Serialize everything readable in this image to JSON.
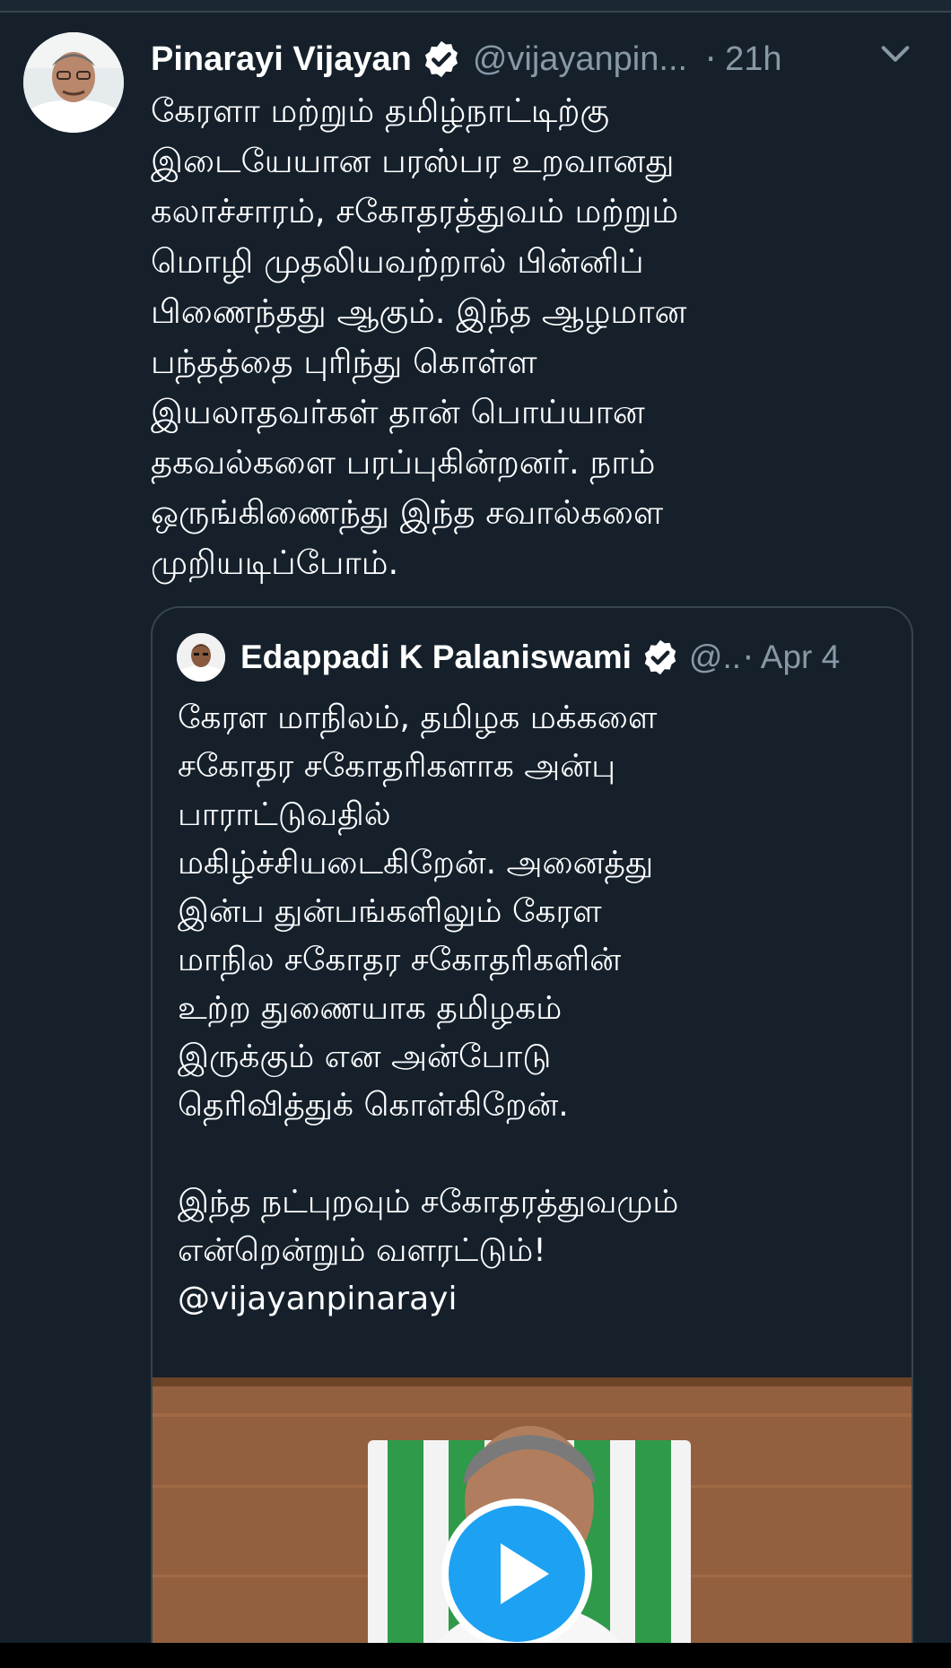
{
  "tweet": {
    "author_name": "Pinarayi Vijayan",
    "author_handle": "@vijayanpin...",
    "time": "21h",
    "separator": "·",
    "text": "கேரளா மற்றும் தமிழ்நாட்டிற்கு\nஇடையேயான பரஸ்பர உறவானது\nகலாச்சாரம், சகோதரத்துவம் மற்றும்\nமொழி முதலியவற்றால் பின்னிப்\nபிணைந்தது ஆகும். இந்த ஆழமான\nபந்தத்தை புரிந்து கொள்ள\nஇயலாதவர்கள் தான் பொய்யான\nதகவல்களை பரப்புகின்றனர். நாம்\nஒருங்கிணைந்து இந்த சவால்களை\nமுறியடிப்போம்.",
    "icons": {
      "verified": "verified-badge-icon",
      "menu": "chevron-down-icon"
    }
  },
  "quoted_tweet": {
    "author_name": "Edappadi K Palaniswami",
    "author_handle": "@..",
    "separator": "·",
    "time": "Apr 4",
    "text": "கேரள மாநிலம், தமிழக மக்களை\nசகோதர சகோதரிகளாக அன்பு\nபாராட்டுவதில்\nமகிழ்ச்சியடைகிறேன். அனைத்து\nஇன்ப துன்பங்களிலும் கேரள\nமாநில சகோதர சகோதரிகளின்\nஉற்ற துணையாக தமிழகம்\nஇருக்கும் என அன்போடு\nதெரிவித்துக் கொள்கிறேன்.\n\nஇந்த நட்புறவும் சகோதரத்துவமும்\nஎன்றென்றும் வளரட்டும்!",
    "mention": "@vijayanpinarayi",
    "media": {
      "type": "video",
      "icon": "play-icon"
    }
  },
  "colors": {
    "background": "#15202b",
    "border": "#38444d",
    "secondary_text": "#8899a6",
    "accent": "#1da1f2"
  }
}
